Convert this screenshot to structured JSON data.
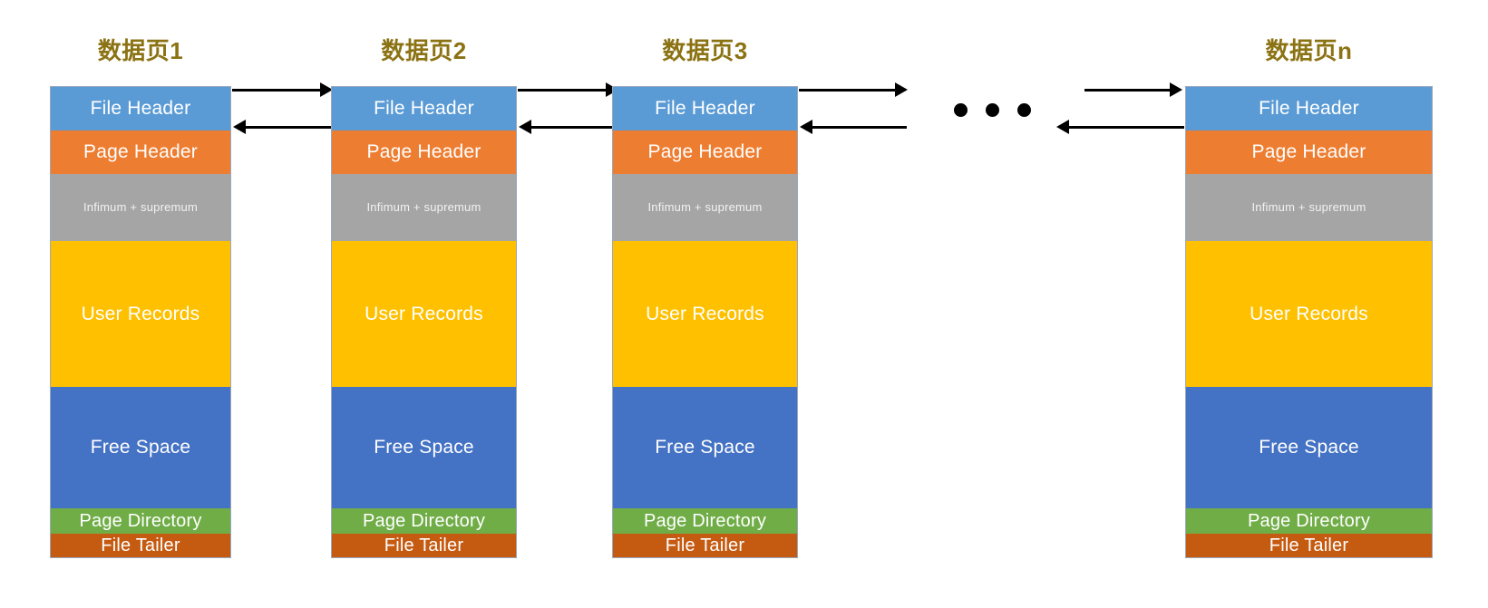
{
  "diagram": {
    "title_color": "#8b7213",
    "background": "#ffffff",
    "arrow_color": "#000000",
    "section_labels": {
      "file_header": "File Header",
      "page_header": "Page Header",
      "infimum_supremum": "Infimum + supremum",
      "user_records": "User Records",
      "free_space": "Free Space",
      "page_directory": "Page Directory",
      "file_tailer": "File Tailer"
    },
    "section_colors": {
      "file_header": "#5b9bd5",
      "page_header": "#ed7d31",
      "infimum_supremum": "#a5a5a5",
      "user_records": "#ffc000",
      "free_space": "#4472c4",
      "page_directory": "#70ad47",
      "file_tailer": "#c55a11"
    },
    "pages": [
      {
        "title": "数据页1",
        "sections": [
          "File Header",
          "Page Header",
          "Infimum + supremum",
          "User Records",
          "Free Space",
          "Page Directory",
          "File Tailer"
        ]
      },
      {
        "title": "数据页2",
        "sections": [
          "File Header",
          "Page Header",
          "Infimum + supremum",
          "User Records",
          "Free Space",
          "Page Directory",
          "File Tailer"
        ]
      },
      {
        "title": "数据页3",
        "sections": [
          "File Header",
          "Page Header",
          "Infimum + supremum",
          "User Records",
          "Free Space",
          "Page Directory",
          "File Tailer"
        ]
      },
      {
        "title": "数据页n",
        "sections": [
          "File Header",
          "Page Header",
          "Infimum + supremum",
          "User Records",
          "Free Space",
          "Page Directory",
          "File Tailer"
        ]
      }
    ],
    "ellipsis": "• • •"
  }
}
